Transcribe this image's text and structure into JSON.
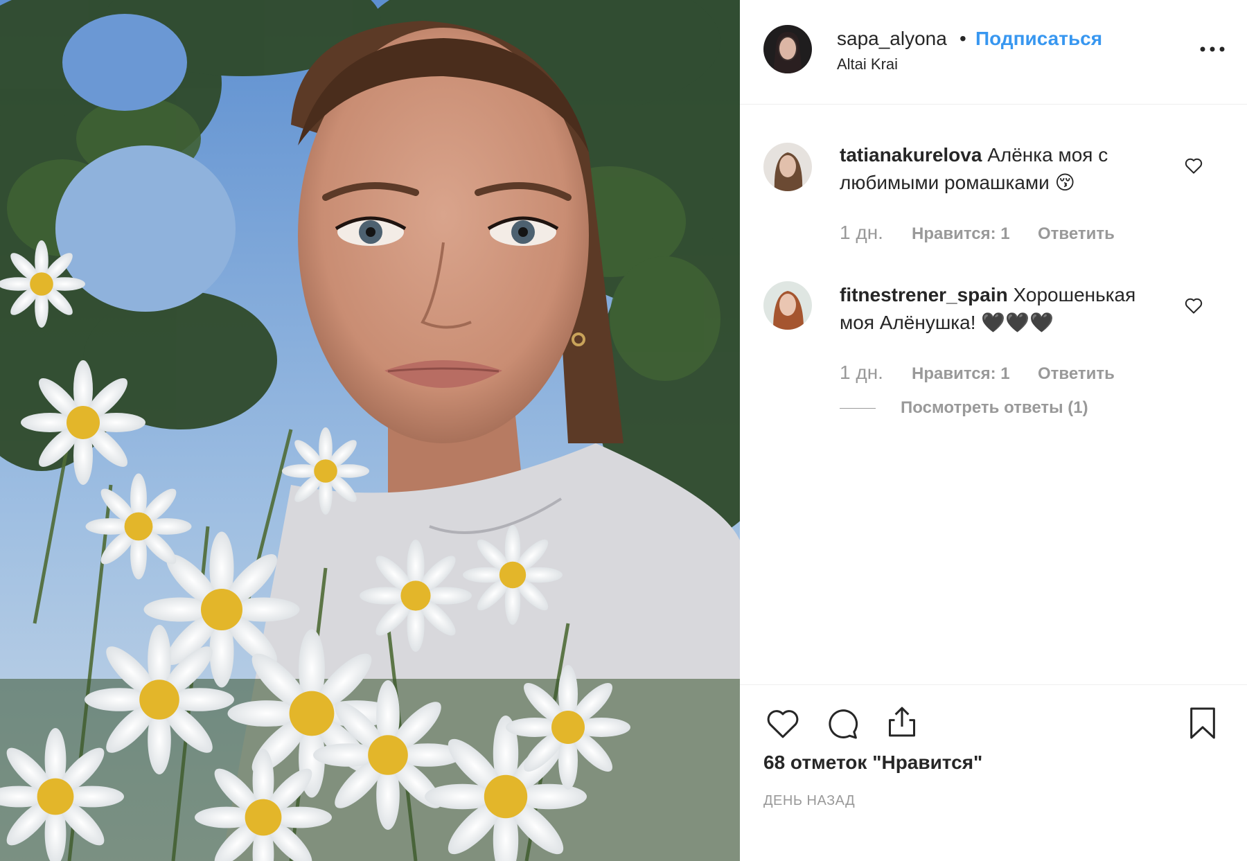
{
  "post": {
    "photo_label": "",
    "header": {
      "username": "sapa_alyona",
      "dot": "•",
      "follow_label": "Подписаться",
      "location": "Altai Krai",
      "more_icon": "more-dots-icon"
    },
    "comments": [
      {
        "author": "tatianakurelova",
        "text": "Алёнка моя с любимыми ромашками 😚",
        "time": "1 дн.",
        "likes": "Нравится: 1",
        "reply_label": "Ответить"
      },
      {
        "author": "fitnestrener_spain",
        "text": "Хорошенькая моя Алёнушка! 🖤🖤🖤",
        "time": "1 дн.",
        "likes": "Нравится: 1",
        "reply_label": "Ответить",
        "view_replies": "Посмотреть ответы (1)"
      }
    ],
    "actions": {
      "like_icon": "heart-icon",
      "comment_icon": "comment-bubble-icon",
      "share_icon": "share-icon",
      "save_icon": "bookmark-icon"
    },
    "likes_count": "68 отметок \"Нравится\"",
    "posted": "ДЕНЬ НАЗАД"
  }
}
